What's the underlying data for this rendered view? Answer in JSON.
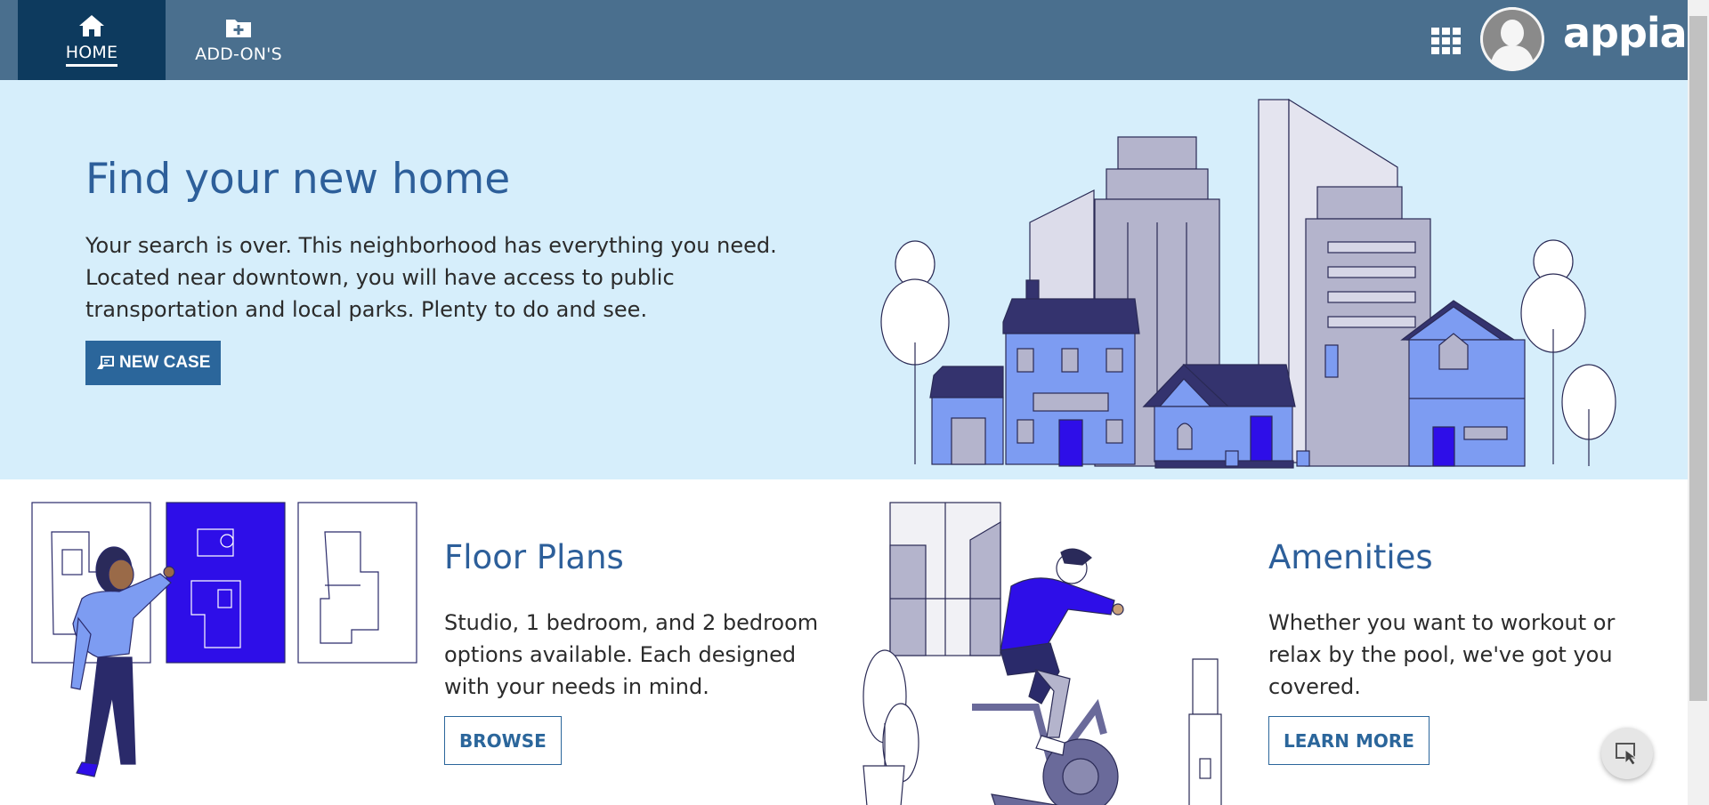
{
  "nav": {
    "home_label": "HOME",
    "addons_label": "ADD-ON'S",
    "logo_text": "appian"
  },
  "hero": {
    "title": "Find your new home",
    "description": "Your search is over. This neighborhood has everything you need. Located near downtown, you will have access to public transportation and local parks. Plenty to do and see.",
    "button_label": "NEW CASE"
  },
  "floor_plans": {
    "title": "Floor Plans",
    "description": "Studio, 1 bedroom, and 2 bedroom options available. Each designed with your needs in mind.",
    "button_label": "BROWSE"
  },
  "amenities": {
    "title": "Amenities",
    "description": "Whether you want to workout or relax by the pool, we've got you covered.",
    "button_label": "LEARN MORE"
  },
  "colors": {
    "topbar": "#4a6f8e",
    "active_tab": "#0d3a5e",
    "hero_bg": "#d6eefb",
    "accent": "#2b669b",
    "title": "#2d5f9a",
    "illustration_blue": "#2e0ee8"
  }
}
